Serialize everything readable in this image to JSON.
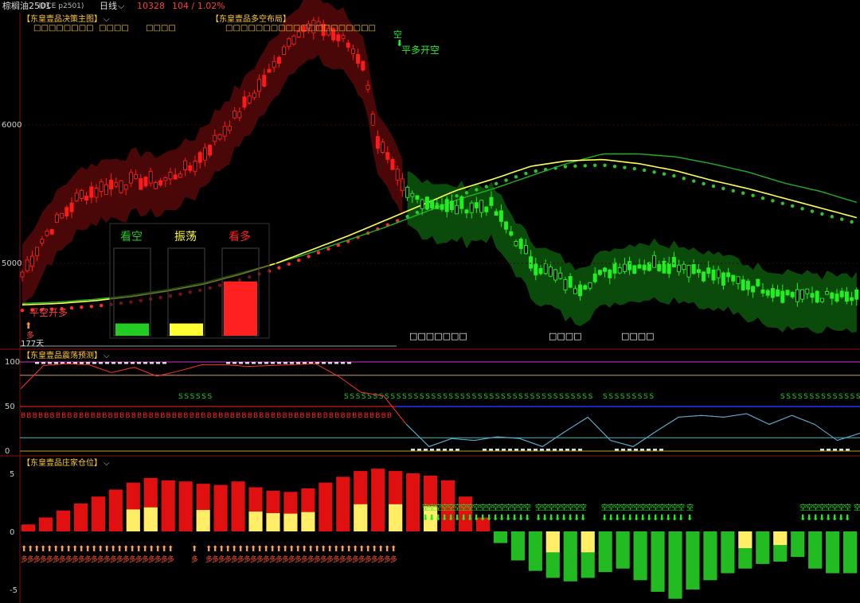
{
  "header": {
    "symbol": "棕榈油2501",
    "superscript": "M",
    "code": "(DCE p2501)",
    "period": "日线",
    "price": "10328",
    "change": "104 / 1.02%"
  },
  "panels": {
    "main": {
      "title": "【东皇壹品决策主图】",
      "title2": "【东皇壹品多空布局】",
      "boxes_a": "□□□□□□□□",
      "boxes_b": "□□□□",
      "boxes_c": "□□□□",
      "boxes_d": "□□□□□□□□□□□□□□□□□□□□",
      "days_label": "177天",
      "bottom_a": "□□□□□□□",
      "bottom_b": "□□□□",
      "bottom_c": "□□□□",
      "signal_long": "平空开多",
      "signal_long_char": "多",
      "signal_short": "平多开空",
      "signal_short_char": "空",
      "y_labels": [
        "6000",
        "5000"
      ]
    },
    "osc": {
      "title": "【东皇壹品震荡预测】",
      "y_labels": [
        "100",
        "50",
        "0"
      ]
    },
    "pos": {
      "title": "【东皇壹品庄家仓位】",
      "y_labels": [
        "5",
        "0",
        "-5"
      ]
    }
  },
  "legend_box": {
    "labels": [
      "看空",
      "振荡",
      "看多"
    ],
    "colors": [
      "#22cc22",
      "#ffff33",
      "#ff2020"
    ],
    "levels": [
      0.14,
      0.14,
      0.62
    ]
  },
  "colors": {
    "up": "#ff1a1a",
    "down": "#22ee22",
    "red_band": "#4a0707",
    "green_band": "#0a4a0a",
    "ma_yellow": "#ffff55",
    "ma_green": "#22b022",
    "accent": "#ffcc33",
    "osc_line": "#44bbdd"
  },
  "chart_data": [
    {
      "type": "candlestick",
      "title": "【东皇壹品决策主图】",
      "y_ticks": [
        6000,
        5000
      ],
      "candles": [],
      "candles_note": "",
      "series": [
        {
          "values": [
            4770,
            4780,
            4800,
            4830,
            4870,
            4920,
            4990,
            5060,
            5140,
            5230,
            5320,
            5420,
            5520,
            5600,
            5690,
            5780,
            5850,
            5850,
            5830,
            5780,
            5720,
            5640,
            5580,
            5500
          ]
        },
        {
          "values": [
            4700,
            4710,
            4730,
            4760,
            4800,
            4850,
            4920,
            5000,
            5100,
            5200,
            5310,
            5420,
            5530,
            5610,
            5700,
            5740,
            5750,
            5720,
            5670,
            5600,
            5540,
            5470,
            5400,
            5330
          ]
        }
      ]
    },
    {
      "type": "line",
      "title": "【东皇壹品震荡预测】",
      "y_ticks": [
        100,
        50,
        0
      ],
      "values": [
        70,
        96,
        98,
        97,
        88,
        94,
        84,
        90,
        97,
        97,
        95,
        96,
        97,
        98,
        84,
        66,
        62,
        30,
        5,
        14,
        12,
        16,
        14,
        5,
        22,
        38,
        12,
        5,
        22,
        38,
        40,
        38,
        42,
        30,
        40,
        30,
        12,
        20
      ]
    },
    {
      "type": "bar",
      "title": "【东皇壹品庄家仓位】",
      "y_ticks": [
        5,
        0,
        -5
      ],
      "values": [
        0.6,
        1.2,
        1.8,
        2.4,
        3.0,
        3.6,
        4.2,
        4.6,
        4.4,
        4.3,
        4.1,
        4.0,
        4.3,
        3.8,
        3.5,
        3.4,
        3.7,
        4.2,
        4.7,
        5.2,
        5.4,
        5.2,
        5.0,
        4.8,
        4.4,
        3.0,
        1.2,
        -1.0,
        -2.5,
        -3.4,
        -4.0,
        -4.3,
        -4.0,
        -3.5,
        -3.2,
        -4.2,
        -5.2,
        -5.8,
        -5.0,
        -4.2,
        -3.6,
        -3.2,
        -2.8,
        -2.6,
        -2.2,
        -3.2,
        -3.6,
        -3.6
      ]
    }
  ]
}
